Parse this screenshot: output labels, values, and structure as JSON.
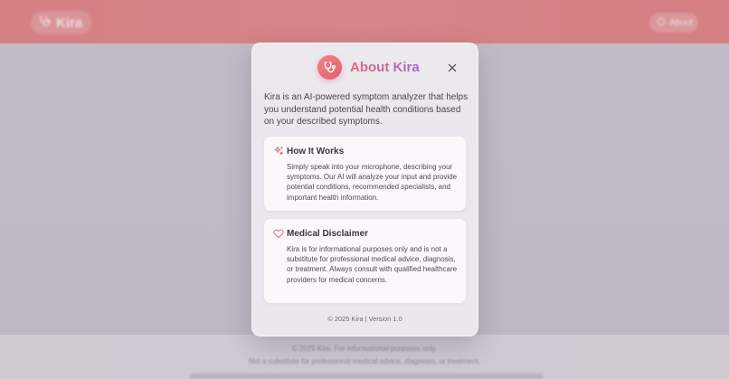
{
  "background": {
    "app_name": "Kira",
    "about_button_label": "About",
    "footer_line_1": "© 2025 Kira. For informational purposes only.",
    "footer_line_2": "Not a substitute for professional medical advice, diagnosis, or treatment."
  },
  "modal": {
    "title": "About Kira",
    "title_icon": "stethoscope-icon",
    "close_icon": "close-icon",
    "intro": "Kira is an AI-powered symptom analyzer that helps you understand potential health conditions based on your described symptoms.",
    "cards": [
      {
        "icon": "sparkles-icon",
        "title": "How It Works",
        "body": "Simply speak into your microphone, describing your symptoms. Our AI will analyze your input and provide potential conditions, recommended specialists, and important health information."
      },
      {
        "icon": "heart-icon",
        "title": "Medical Disclaimer",
        "body": "Kira is for informational purposes only and is not a substitute for professional medical advice, diagnosis, or treatment. Always consult with qualified healthcare providers for medical concerns."
      }
    ],
    "footer": "© 2025 Kira | Version 1.0"
  },
  "colors": {
    "header": "#e07f80",
    "accent_pink": "#e46a78",
    "accent_purple": "#a46ac8",
    "card_icon": "#e46a78"
  }
}
